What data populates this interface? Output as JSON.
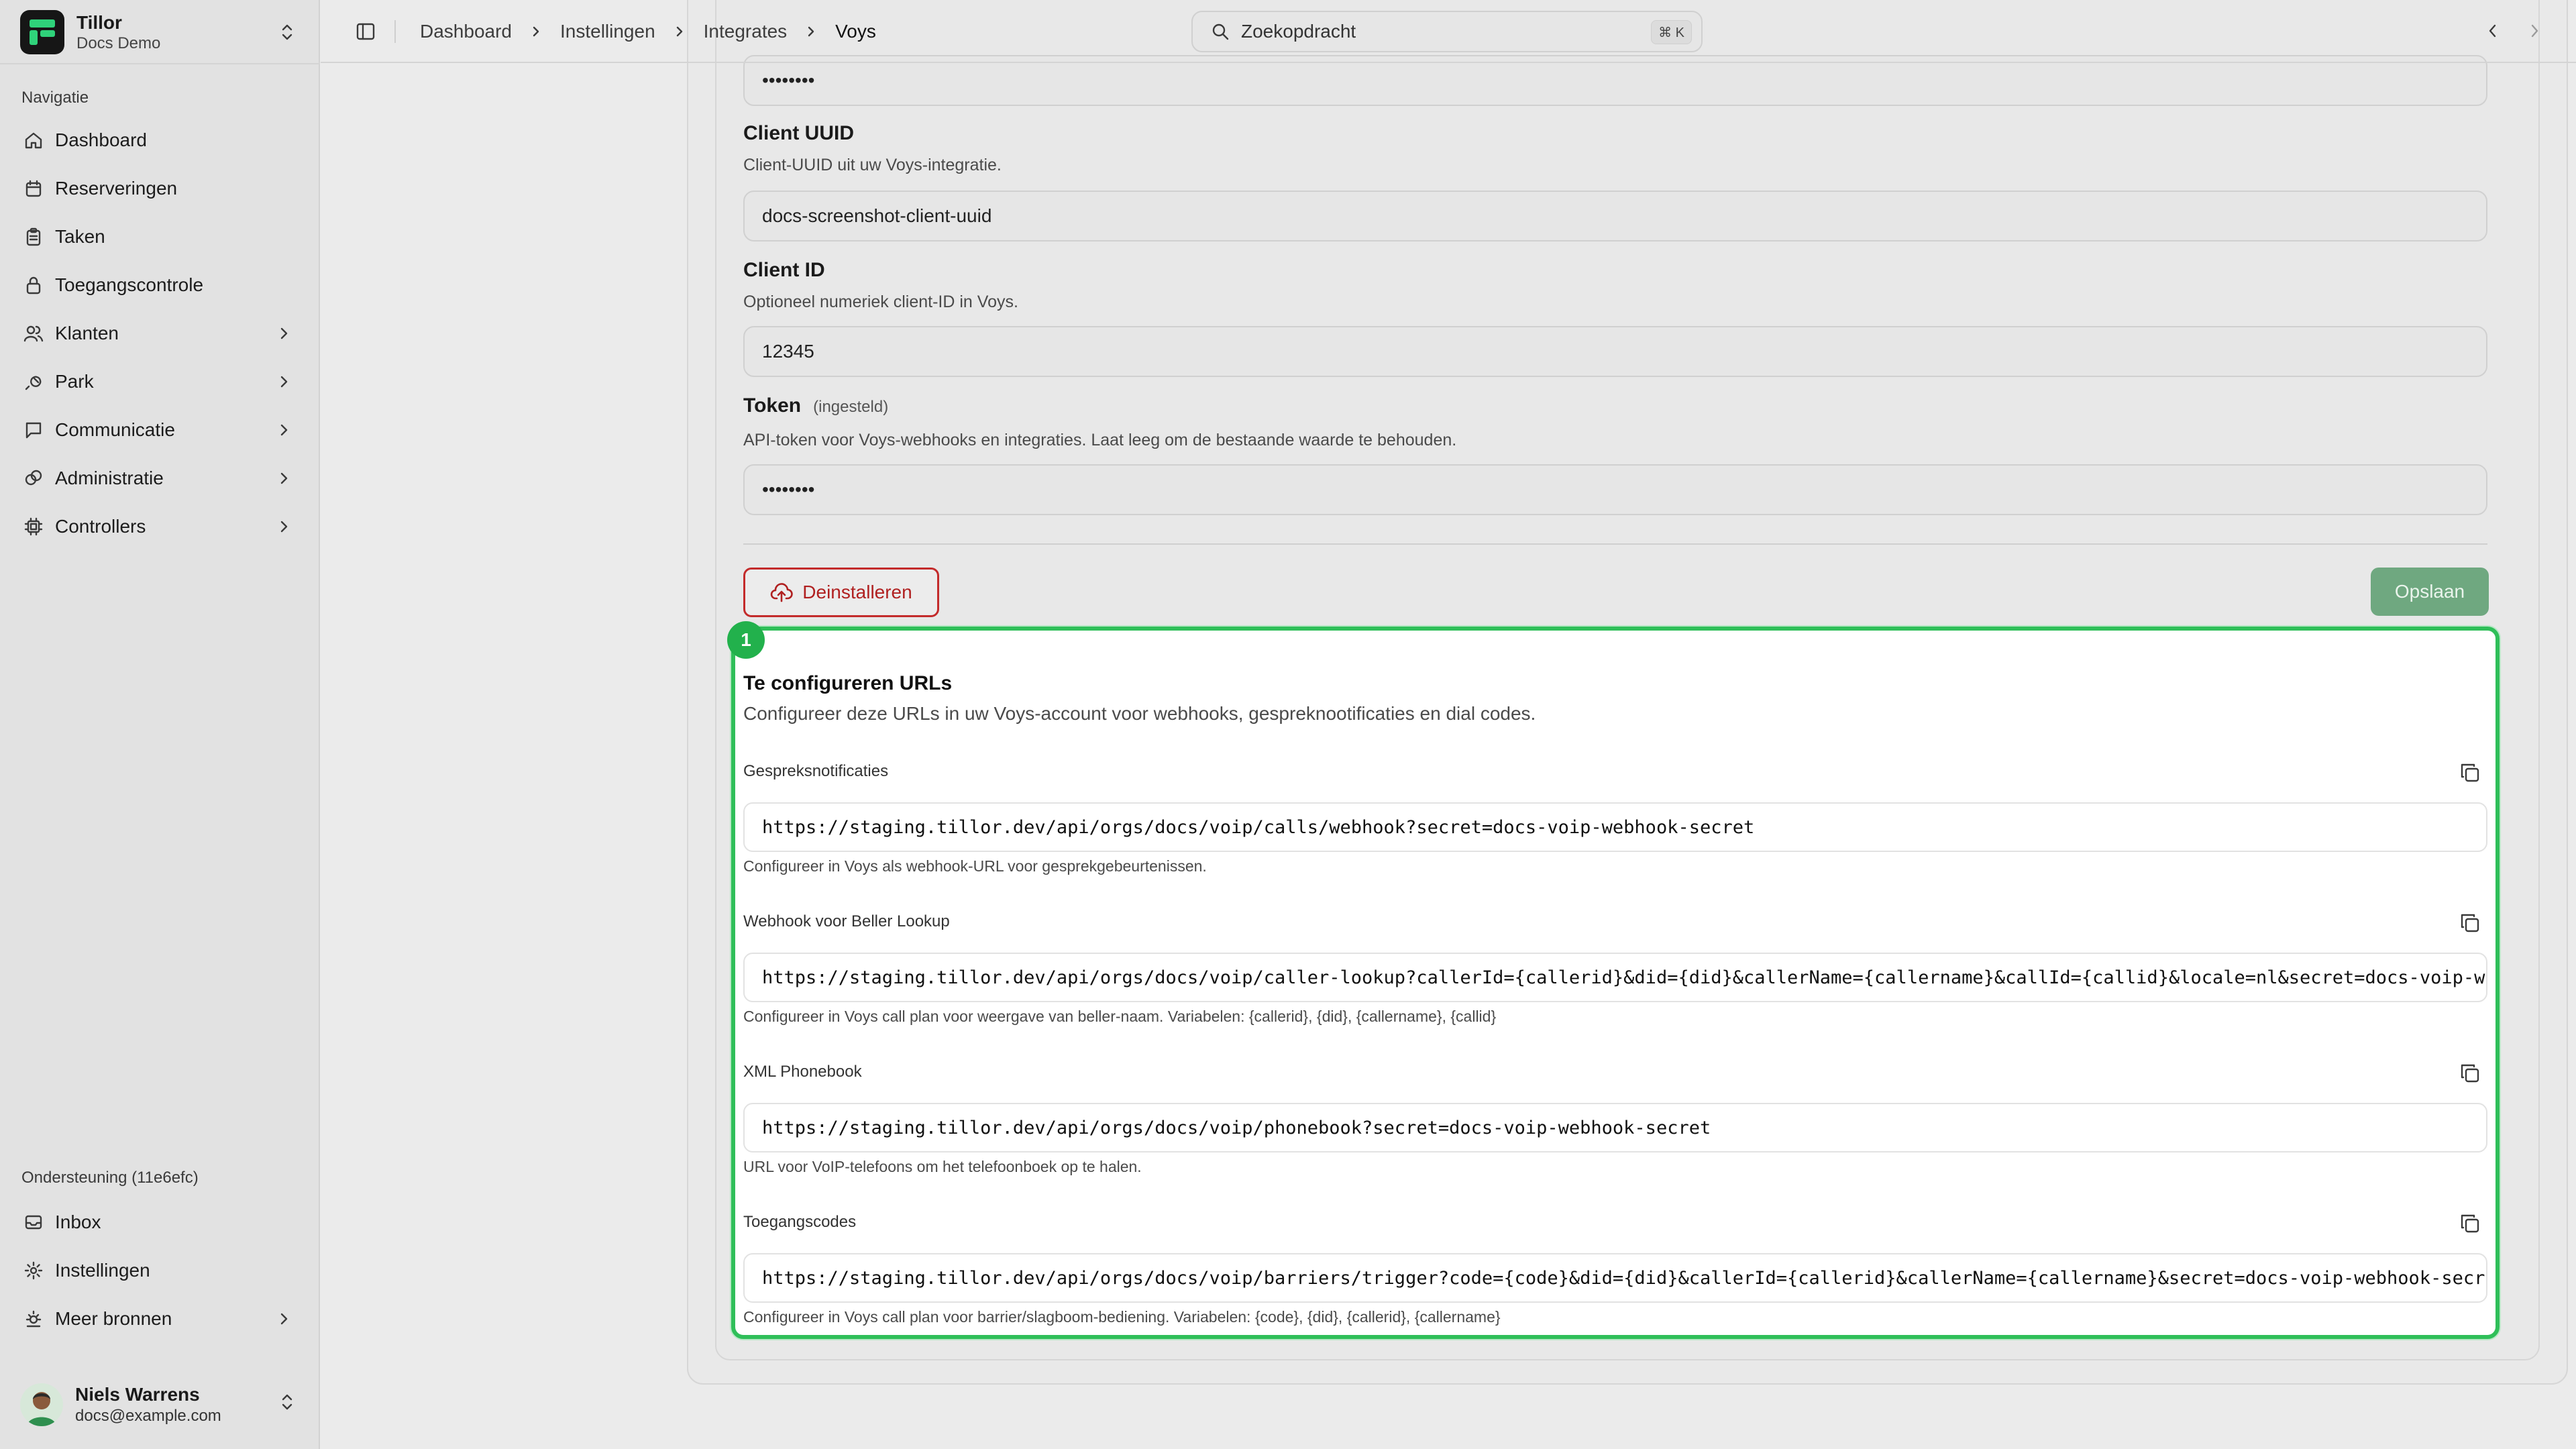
{
  "team": {
    "name": "Tillor",
    "subtitle": "Docs Demo"
  },
  "sidebar": {
    "nav_label": "Navigatie",
    "nav_items": [
      {
        "label": "Dashboard",
        "icon": "home-icon"
      },
      {
        "label": "Reserveringen",
        "icon": "calendar-icon"
      },
      {
        "label": "Taken",
        "icon": "clipboard-icon"
      },
      {
        "label": "Toegangscontrole",
        "icon": "lock-icon"
      },
      {
        "label": "Klanten",
        "icon": "users-icon",
        "expandable": true
      },
      {
        "label": "Park",
        "icon": "map-pin-icon",
        "expandable": true
      },
      {
        "label": "Communicatie",
        "icon": "message-icon",
        "expandable": true
      },
      {
        "label": "Administratie",
        "icon": "coins-icon",
        "expandable": true
      },
      {
        "label": "Controllers",
        "icon": "chip-icon",
        "expandable": true
      }
    ],
    "support_label": "Ondersteuning (11e6efc)",
    "support_items": [
      {
        "label": "Inbox",
        "icon": "inbox-icon"
      },
      {
        "label": "Instellingen",
        "icon": "gear-icon"
      },
      {
        "label": "Meer bronnen",
        "icon": "sun-icon",
        "expandable": true
      }
    ]
  },
  "user": {
    "name": "Niels Warrens",
    "email": "docs@example.com"
  },
  "breadcrumb": [
    "Dashboard",
    "Instellingen",
    "Integrates",
    "Voys"
  ],
  "search": {
    "placeholder": "Zoekopdracht",
    "shortcut": "⌘ K"
  },
  "form": {
    "hidden_top_value": "••••••••",
    "fields": [
      {
        "label": "Client UUID",
        "description": "Client-UUID uit uw Voys-integratie.",
        "value": "docs-screenshot-client-uuid"
      },
      {
        "label": "Client ID",
        "description": "Optioneel numeriek client-ID in Voys.",
        "value": "12345"
      },
      {
        "label": "Token",
        "tag": "(ingesteld)",
        "description": "API-token voor Voys-webhooks en integraties. Laat leeg om de bestaande waarde te behouden.",
        "value": "••••••••"
      }
    ],
    "uninstall_label": "Deinstalleren",
    "save_label": "Opslaan"
  },
  "urls": {
    "marker": "1",
    "title": "Te configureren URLs",
    "description": "Configureer deze URLs in uw Voys-account voor webhooks, gespreknootificaties en dial codes.",
    "items": [
      {
        "label": "Gespreksnotificaties",
        "url": "https://staging.tillor.dev/api/orgs/docs/voip/calls/webhook?secret=docs-voip-webhook-secret",
        "note": "Configureer in Voys als webhook-URL voor gesprekgebeurtenissen."
      },
      {
        "label": "Webhook voor Beller Lookup",
        "url": "https://staging.tillor.dev/api/orgs/docs/voip/caller-lookup?callerId={callerid}&did={did}&callerName={callername}&callId={callid}&locale=nl&secret=docs-voip-webhook-secret",
        "note": "Configureer in Voys call plan voor weergave van beller-naam. Variabelen: {callerid}, {did}, {callername}, {callid}"
      },
      {
        "label": "XML Phonebook",
        "url": "https://staging.tillor.dev/api/orgs/docs/voip/phonebook?secret=docs-voip-webhook-secret",
        "note": "URL voor VoIP-telefoons om het telefoonboek op te halen."
      },
      {
        "label": "Toegangscodes",
        "url": "https://staging.tillor.dev/api/orgs/docs/voip/barriers/trigger?code={code}&did={did}&callerId={callerid}&callerName={callername}&secret=docs-voip-webhook-secret",
        "note": "Configureer in Voys call plan voor barrier/slagboom-bediening. Variabelen: {code}, {did}, {callerid}, {callername}"
      }
    ]
  },
  "colors": {
    "accent_green": "#22b14c",
    "danger_red": "#c32b2b",
    "save_green": "#6fa880"
  }
}
